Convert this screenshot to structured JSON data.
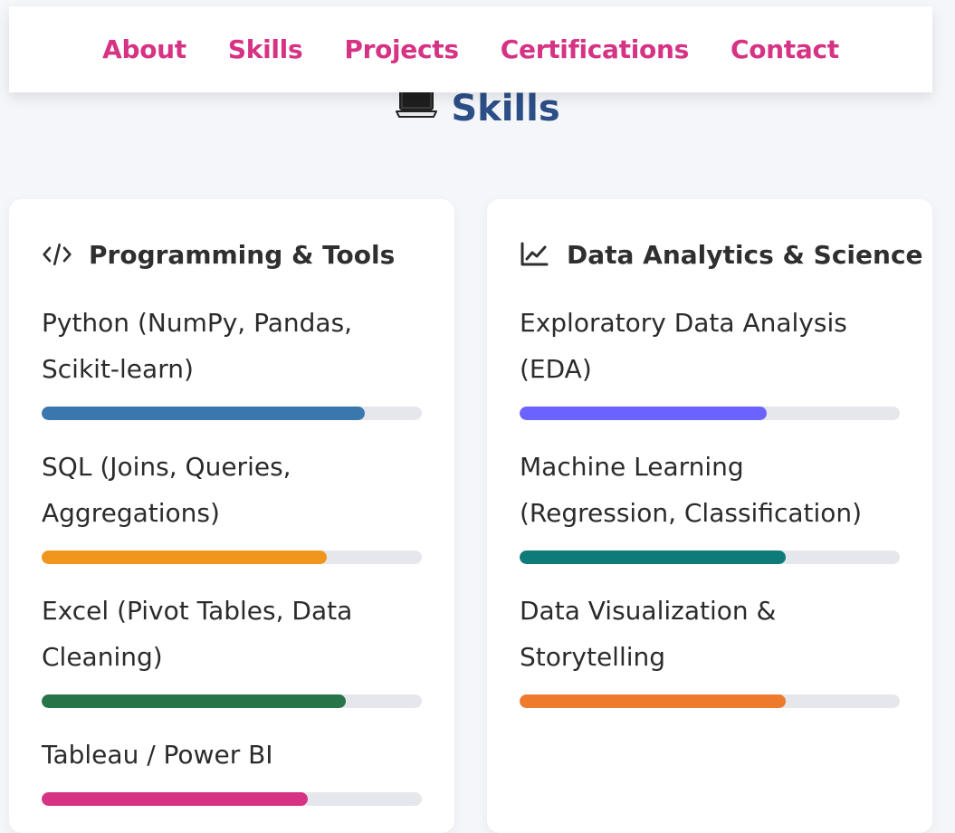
{
  "nav": {
    "links": [
      "About",
      "Skills",
      "Projects",
      "Certifications",
      "Contact"
    ]
  },
  "section": {
    "title": "Skills",
    "icon": "laptop-icon"
  },
  "cards": [
    {
      "title": "Programming & Tools",
      "icon": "code-icon",
      "skills": [
        {
          "label": "Python (NumPy, Pandas, Scikit-learn)",
          "level": 0.85,
          "color": "#3a77ad"
        },
        {
          "label": "SQL (Joins, Queries, Aggregations)",
          "level": 0.75,
          "color": "#f0961c"
        },
        {
          "label": "Excel (Pivot Tables, Data Cleaning)",
          "level": 0.8,
          "color": "#267447"
        },
        {
          "label": "Tableau / Power BI",
          "level": 0.7,
          "color": "#d63384"
        }
      ]
    },
    {
      "title": "Data Analytics & Science",
      "icon": "chart-line-icon",
      "skills": [
        {
          "label": "Exploratory Data Analysis (EDA)",
          "level": 0.65,
          "color": "#6c63ff"
        },
        {
          "label": "Machine Learning (Regression, Classification)",
          "level": 0.7,
          "color": "#0e7b78"
        },
        {
          "label": "Data Visualization & Storytelling",
          "level": 0.7,
          "color": "#ee7a2c"
        }
      ]
    }
  ]
}
